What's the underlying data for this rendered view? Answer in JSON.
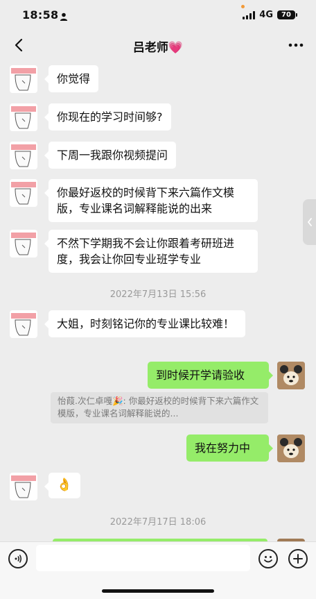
{
  "status_bar": {
    "time": "18:58",
    "network": "4G",
    "battery": "70"
  },
  "nav": {
    "title": "吕老师💗",
    "back_icon": "chevron-left-icon",
    "more_icon": "more-dots-icon"
  },
  "messages": [
    {
      "sender": "teacher",
      "text": "你觉得"
    },
    {
      "sender": "teacher",
      "text": "你现在的学习时间够?"
    },
    {
      "sender": "teacher",
      "text": "下周一我跟你视频提问"
    },
    {
      "sender": "teacher",
      "text": "你最好返校的时候背下来六篇作文模版，专业课名词解释能说的出来"
    },
    {
      "sender": "teacher",
      "text": "不然下学期我不会让你跟着考研班进度，我会让你回专业班学专业"
    },
    {
      "timestamp": "2022年7月13日 15:56"
    },
    {
      "sender": "teacher",
      "text": "大姐，时刻铭记你的专业课比较难！"
    },
    {
      "sender": "me",
      "text": "到时候开学请验收"
    },
    {
      "quote": "怡葭.次仁卓嘎🎉: 你最好返校的时候背下来六篇作文模版，专业课名词解释能说的..."
    },
    {
      "sender": "me",
      "text": "我在努力中"
    },
    {
      "sender": "teacher",
      "text": "👌"
    },
    {
      "timestamp": "2022年7月17日 18:06"
    }
  ],
  "input_bar": {
    "placeholder": ""
  },
  "colors": {
    "background": "#ededed",
    "my_bubble": "#95ec69",
    "their_bubble": "#ffffff"
  }
}
